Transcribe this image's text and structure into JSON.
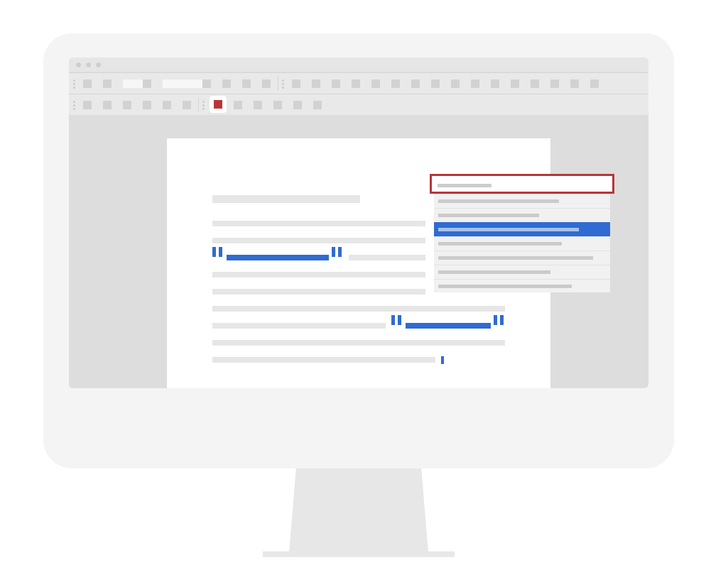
{
  "colors": {
    "accent_blue": "#2f6bd1",
    "highlight_red": "#b7353a",
    "monitor_body": "#f4f4f4",
    "screen_bg": "#dddddd",
    "toolbar_bg": "#e9e9e9",
    "page_bg": "#ffffff"
  },
  "window": {
    "controls": [
      "window-dot-icon",
      "window-dot-icon",
      "window-dot-icon"
    ]
  },
  "toolbar_row1": {
    "group1_buttons": 4,
    "fields": 2,
    "group2_buttons": 16
  },
  "toolbar_row2": {
    "group1_buttons": 6,
    "highlighted_button_icon": "square-icon",
    "group2_buttons": 5
  },
  "document": {
    "placeholder_only": true,
    "links": 2,
    "caret_visible": true
  },
  "dropdown": {
    "search_field_highlighted": true,
    "items": 7,
    "selected_index": 2
  }
}
